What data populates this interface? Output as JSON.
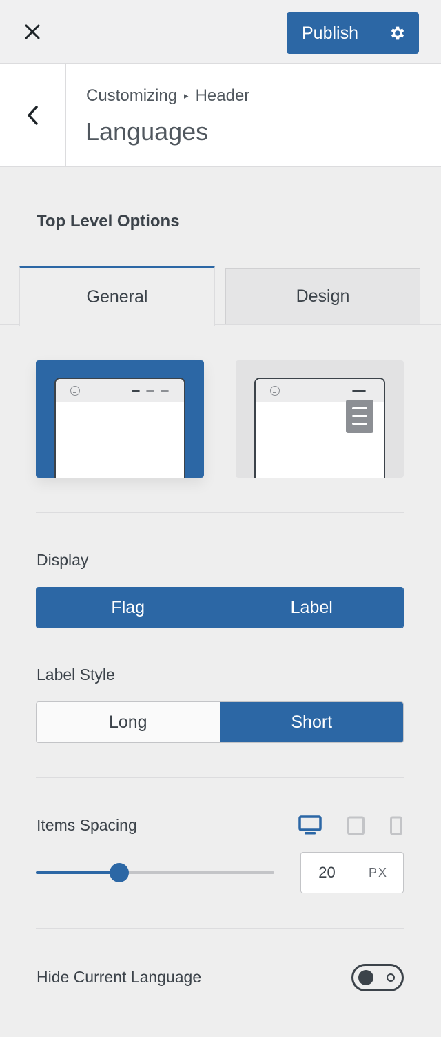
{
  "header": {
    "publish_label": "Publish"
  },
  "section": {
    "breadcrumb_root": "Customizing",
    "breadcrumb_sep": "▸",
    "breadcrumb_current": "Header",
    "title": "Languages"
  },
  "options_title": "Top Level Options",
  "tabs": [
    {
      "label": "General",
      "active": true
    },
    {
      "label": "Design",
      "active": false
    }
  ],
  "layouts": [
    {
      "name": "desktop",
      "selected": true
    },
    {
      "name": "mobile",
      "selected": false
    }
  ],
  "display": {
    "label": "Display",
    "options": [
      {
        "label": "Flag",
        "active": true
      },
      {
        "label": "Label",
        "active": true
      }
    ]
  },
  "label_style": {
    "label": "Label Style",
    "options": [
      {
        "label": "Long",
        "active": false
      },
      {
        "label": "Short",
        "active": true
      }
    ]
  },
  "items_spacing": {
    "label": "Items Spacing",
    "value": "20",
    "unit": "PX",
    "slider_fraction": 0.35,
    "devices": [
      {
        "name": "desktop-icon",
        "active": true
      },
      {
        "name": "tablet-icon",
        "active": false
      },
      {
        "name": "mobile-icon",
        "active": false
      }
    ]
  },
  "hide_current": {
    "label": "Hide Current Language",
    "enabled": false
  },
  "colors": {
    "accent": "#2c67a5",
    "panel_bg": "#eeeeee"
  }
}
